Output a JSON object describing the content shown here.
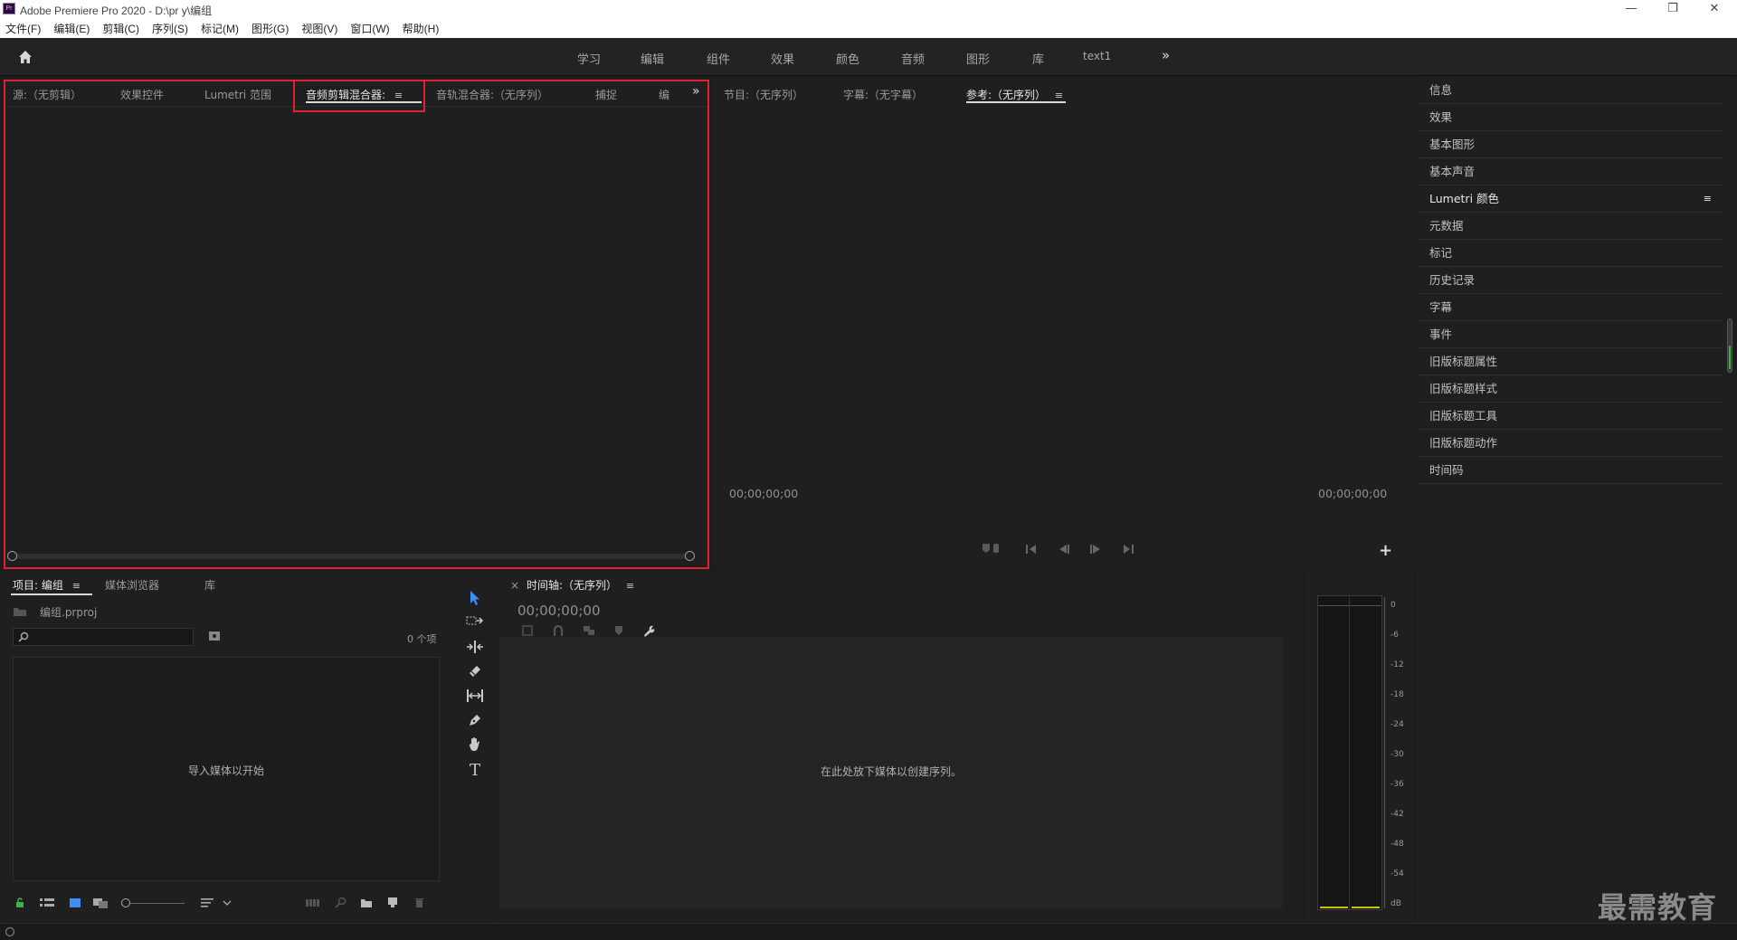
{
  "window": {
    "title": "Adobe Premiere Pro 2020 - D:\\pr y\\编组",
    "app_icon_text": "Pr",
    "minimize": "—",
    "restore": "❐",
    "close": "✕"
  },
  "menu": [
    "文件(F)",
    "编辑(E)",
    "剪辑(C)",
    "序列(S)",
    "标记(M)",
    "图形(G)",
    "视图(V)",
    "窗口(W)",
    "帮助(H)"
  ],
  "workspaces": [
    "学习",
    "编辑",
    "组件",
    "效果",
    "颜色",
    "音频",
    "图形",
    "库",
    "text1"
  ],
  "workspace_overflow": "»",
  "source_panel": {
    "tabs": [
      "源:（无剪辑）",
      "效果控件",
      "Lumetri 范围",
      "音频剪辑混合器:",
      "音轨混合器:（无序列）",
      "捕捉",
      "编"
    ],
    "active_tab_index": 3,
    "menu_glyph": "≡",
    "overflow": "»"
  },
  "program_panel": {
    "tabs": [
      "节目:（无序列）",
      "字幕:（无字幕）",
      "参考:（无序列）"
    ],
    "active_tab_index": 2,
    "menu_glyph": "≡",
    "timecode_left": "00;00;00;00",
    "timecode_right": "00;00;00;00",
    "add_button": "+"
  },
  "right_panel": {
    "items": [
      "信息",
      "效果",
      "基本图形",
      "基本声音",
      "Lumetri 颜色",
      "元数据",
      "标记",
      "历史记录",
      "字幕",
      "事件",
      "旧版标题属性",
      "旧版标题样式",
      "旧版标题工具",
      "旧版标题动作",
      "时间码"
    ],
    "lumetri_menu": "≡"
  },
  "project_panel": {
    "tabs": [
      "项目: 编组",
      "媒体浏览器",
      "库"
    ],
    "active_tab_index": 0,
    "menu_glyph": "≡",
    "file_name": "编组.prproj",
    "item_count": "0 个项",
    "empty_message": "导入媒体以开始"
  },
  "timeline_panel": {
    "close": "×",
    "title": "时间轴:（无序列）",
    "menu_glyph": "≡",
    "timecode": "00;00;00;00",
    "empty_message": "在此处放下媒体以创建序列。"
  },
  "audio_meter": {
    "labels": [
      "0",
      "-6",
      "-12",
      "-18",
      "-24",
      "-30",
      "-36",
      "-42",
      "-48",
      "-54",
      "dB"
    ]
  },
  "watermark": "最需教育",
  "colors": {
    "highlight_border": "#e0202f",
    "selected_tool": "#3d8ef5",
    "meter_level": "#c9c20a"
  }
}
